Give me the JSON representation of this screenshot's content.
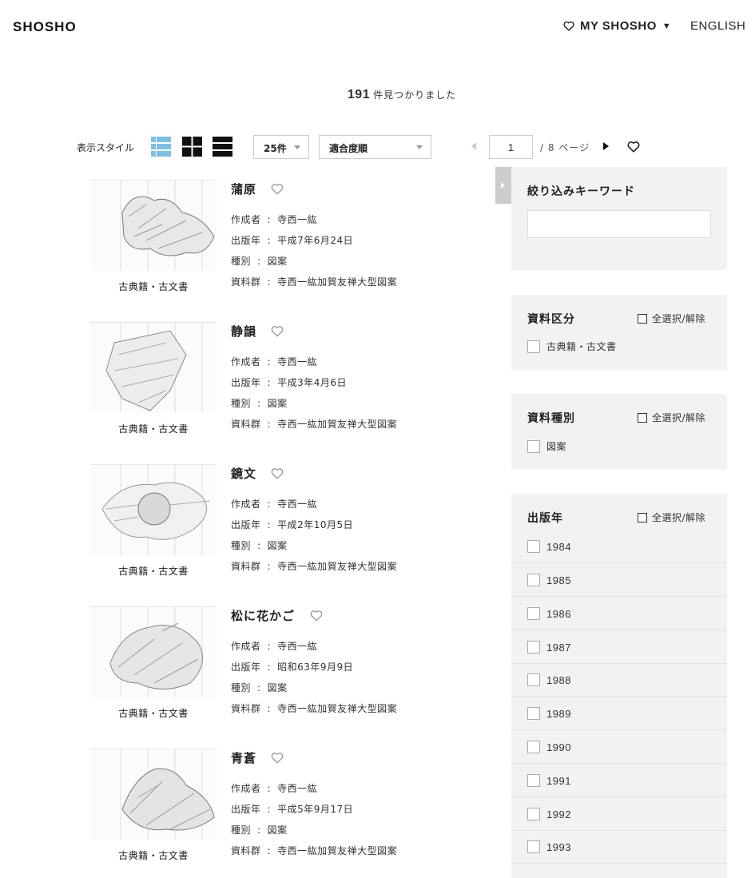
{
  "header": {
    "logo": "SHOSHO",
    "my_shosho": "MY SHOSHO",
    "language": "ENGLISH"
  },
  "results_summary": {
    "count": "191",
    "suffix": "件見つかりました"
  },
  "toolbar": {
    "style_label": "表示スタイル",
    "per_page": "25件",
    "sort": "適合度順",
    "page_current": "1",
    "page_total": "/ 8 ページ"
  },
  "results": [
    {
      "title": "蒲原",
      "creator_label": "作成者",
      "creator": "寺西一紘",
      "date_label": "出版年",
      "date": "平成7年6月24日",
      "type_label": "種別",
      "type": "図案",
      "collection_label": "資料群",
      "collection": "寺西一紘加賀友禅大型図案",
      "category": "古典籍・古文書"
    },
    {
      "title": "静韻",
      "creator_label": "作成者",
      "creator": "寺西一紘",
      "date_label": "出版年",
      "date": "平成3年4月6日",
      "type_label": "種別",
      "type": "図案",
      "collection_label": "資料群",
      "collection": "寺西一紘加賀友禅大型図案",
      "category": "古典籍・古文書"
    },
    {
      "title": "鏡文",
      "creator_label": "作成者",
      "creator": "寺西一紘",
      "date_label": "出版年",
      "date": "平成2年10月5日",
      "type_label": "種別",
      "type": "図案",
      "collection_label": "資料群",
      "collection": "寺西一紘加賀友禅大型図案",
      "category": "古典籍・古文書"
    },
    {
      "title": "松に花かご",
      "creator_label": "作成者",
      "creator": "寺西一紘",
      "date_label": "出版年",
      "date": "昭和63年9月9日",
      "type_label": "種別",
      "type": "図案",
      "collection_label": "資料群",
      "collection": "寺西一紘加賀友禅大型図案",
      "category": "古典籍・古文書"
    },
    {
      "title": "青蒼",
      "creator_label": "作成者",
      "creator": "寺西一紘",
      "date_label": "出版年",
      "date": "平成5年9月17日",
      "type_label": "種別",
      "type": "図案",
      "collection_label": "資料群",
      "collection": "寺西一紘加賀友禅大型図案",
      "category": "古典籍・古文書"
    }
  ],
  "filters": {
    "keyword_title": "絞り込みキーワード",
    "select_all": "全選択/解除",
    "material_section": {
      "title": "資料区分",
      "options": [
        "古典籍・古文書"
      ]
    },
    "kind_section": {
      "title": "資料種別",
      "options": [
        "図案"
      ]
    },
    "year_section": {
      "title": "出版年",
      "options": [
        "1984",
        "1985",
        "1986",
        "1987",
        "1988",
        "1989",
        "1990",
        "1991",
        "1992",
        "1993"
      ]
    }
  },
  "colors": {
    "accent_view_icon": "#7fbfe6",
    "panel_bg": "#f2f2f2",
    "toggle_bg": "#cccccc"
  }
}
